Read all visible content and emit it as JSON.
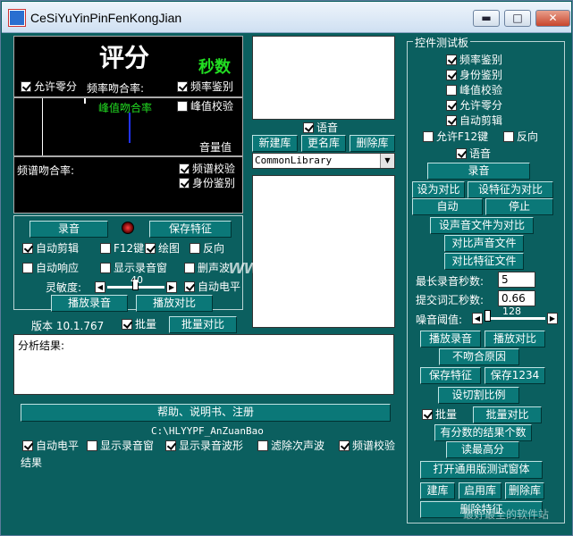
{
  "window": {
    "title": "CeSiYuYinPinFenKongJian",
    "min": "▬",
    "max": "□",
    "close": "✕"
  },
  "score": {
    "title": "评分",
    "unit": "秒数",
    "allow_zero": "允许零分",
    "freq_match": "频率吻合率:",
    "freq_identify": "频率鉴别",
    "peak_match": "峰值吻合率",
    "peak_verify": "峰值校验",
    "volume": "音量值",
    "spectrum_match": "频谱吻合率:",
    "spectrum_verify": "频谱校验",
    "identity": "身份鉴别"
  },
  "left_controls": {
    "record": "录音",
    "save_feature": "保存特征",
    "auto_clip": "自动剪辑",
    "f12": "F12键",
    "plot": "绘图",
    "reverse": "反向",
    "auto_response": "自动响应",
    "show_record_window": "显示录音窗",
    "delete_sound": "删声波",
    "sensitivity": "灵敏度:",
    "sensitivity_value": "40",
    "auto_level": "自动电平",
    "play_record": "播放录音",
    "play_compare": "播放对比"
  },
  "version": {
    "label": "版本 10.1.767",
    "batch": "批量",
    "batch_compare": "批量对比"
  },
  "analysis": {
    "label": "分析结果:"
  },
  "help": {
    "button": "帮助、说明书、注册",
    "path": "C:\\HLYYPF_AnZuanBao"
  },
  "bottom_checks": {
    "auto_level": "自动电平",
    "show_record_window": "显示录音窗",
    "show_wave": "显示录音波形",
    "filter_wave": "滤除次声波",
    "spectrum_verify": "频谱校验",
    "result": "结果"
  },
  "library": {
    "voice": "语音",
    "new_lib": "新建库",
    "rename_lib": "更名库",
    "delete_lib": "删除库",
    "selected": "CommonLibrary",
    "dropdown_arrow": "▼"
  },
  "test_panel": {
    "title": "控件测试板",
    "freq_identify": "频率鉴别",
    "identity": "身份鉴别",
    "peak_verify": "峰值校验",
    "allow_zero": "允许零分",
    "auto_clip": "自动剪辑",
    "allow_f12": "允许F12键",
    "reverse": "反向",
    "voice": "语音",
    "record": "录音",
    "set_compare": "设为对比",
    "set_feature_compare": "设特征为对比",
    "auto": "自动",
    "stop": "停止",
    "set_sound_file_compare": "设声音文件为对比",
    "compare_sound_file": "对比声音文件",
    "compare_feature_file": "对比特征文件",
    "max_record_seconds": "最长录音秒数:",
    "max_record_value": "5",
    "submit_vocab_seconds": "提交词汇秒数:",
    "submit_vocab_value": "0.66",
    "noise_threshold": "噪音阈值:",
    "noise_value": "128",
    "play_record": "播放录音",
    "play_compare": "播放对比",
    "mismatch_reason": "不吻合原因",
    "save_feature": "保存特征",
    "save_1234": "保存1234",
    "set_cut_ratio": "设切割比例",
    "batch": "批量",
    "batch_compare": "批量对比",
    "score_results_count": "有分数的结果个数",
    "read_highest": "读最高分",
    "open_generic_window": "打开通用版测试窗体",
    "build_lib": "建库",
    "apply_lib": "启用库",
    "delete_lib": "删除库",
    "delete_feature": "删除特征"
  },
  "watermark": {
    "text": "www.DuoTe.com",
    "corner_text": "最好最全的软件站"
  }
}
